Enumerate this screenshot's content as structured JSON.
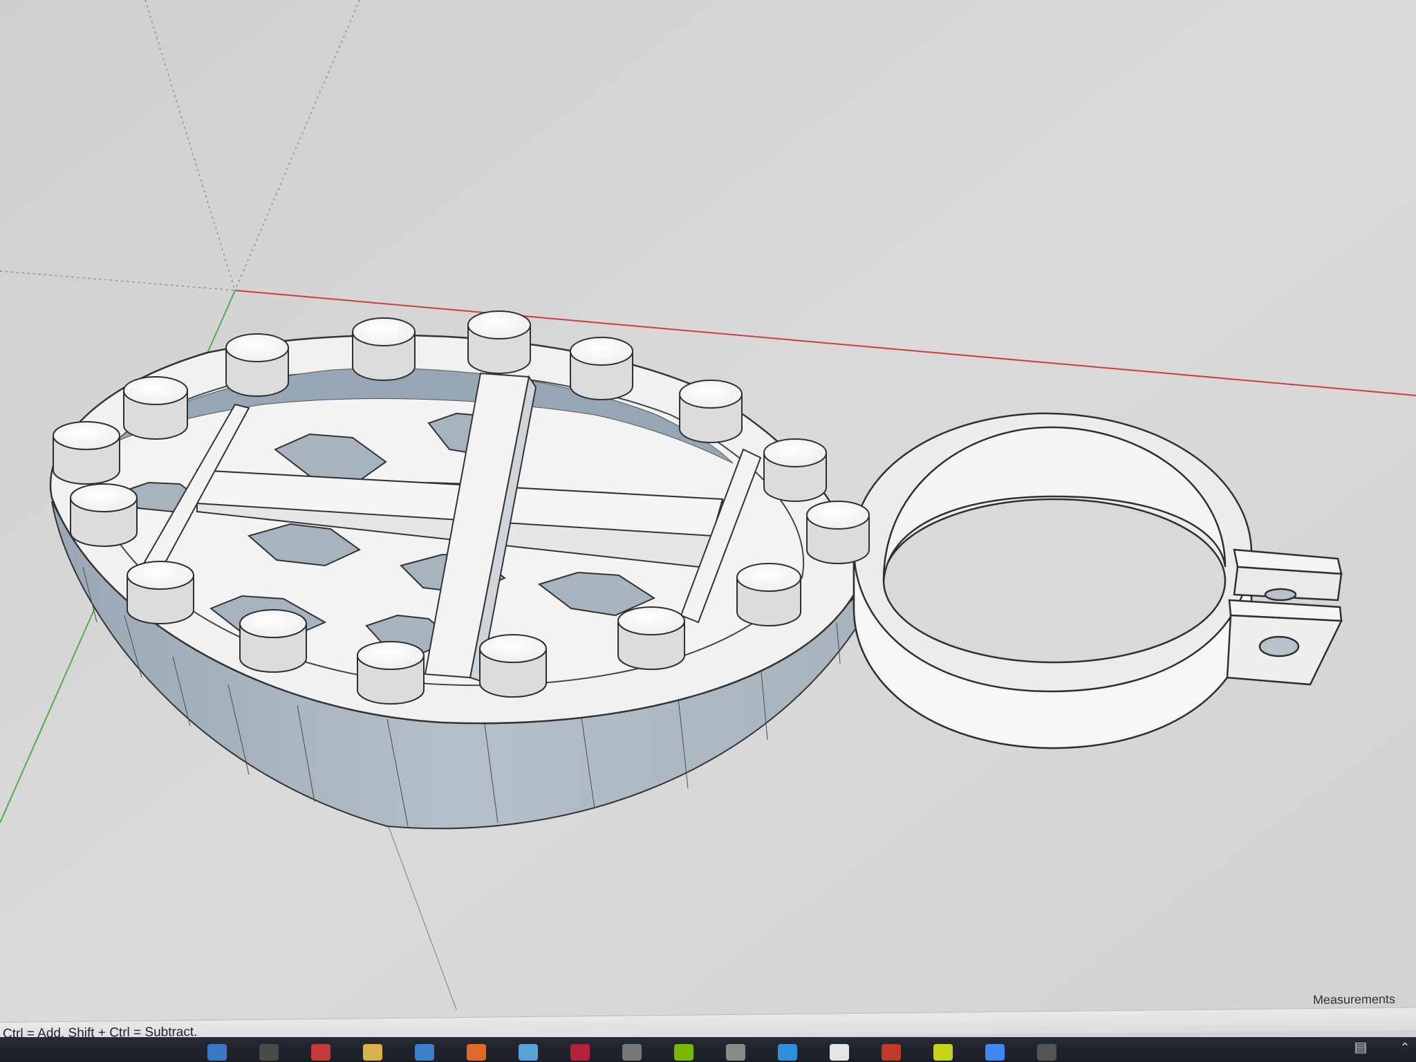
{
  "app": {
    "status_hint": "Ctrl = Add, Shift + Ctrl = Subtract.",
    "measurements_label": "Measurements"
  },
  "scene": {
    "object": "3d-model-basket-with-ring-clamp",
    "red_axis_color": "#d23b3b",
    "green_axis_color": "#4caf50",
    "background_color": "#d8d8d8"
  },
  "taskbar": {
    "icons": [
      "explorer-icon",
      "store-icon",
      "record-icon",
      "folder-icon",
      "mail-icon",
      "sketchup-icon",
      "calc-icon",
      "media-icon",
      "terminal-icon",
      "nvidia-icon",
      "files-icon",
      "photo-icon",
      "ylauncher-icon",
      "amd-icon",
      "cube-icon",
      "chrome-icon",
      "settings-icon"
    ],
    "icon_colors": [
      "#3b78c4",
      "#4a4a4a",
      "#c23a3a",
      "#d9b24b",
      "#3d7fc8",
      "#e06a2b",
      "#5aa0d8",
      "#b4233a",
      "#777777",
      "#76b900",
      "#8a8a8a",
      "#2f8fd8",
      "#e4e4e4",
      "#c0392b",
      "#c7d21b",
      "#4285f4",
      "#555555"
    ],
    "tray_icon": "notifications-icon",
    "tray_chevron": "chevron-up-icon"
  }
}
